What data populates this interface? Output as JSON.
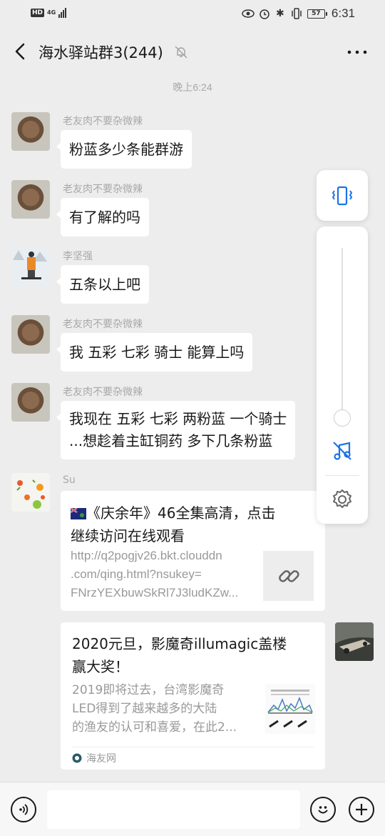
{
  "status_bar": {
    "hd": "HD",
    "network": "4G",
    "battery": "57",
    "time": "6:31"
  },
  "header": {
    "title": "海水驿站群3(244)"
  },
  "timestamp": "晚上6:24",
  "messages": [
    {
      "sender": "老友肉不要杂微辣",
      "text": "粉蓝多少条能群游"
    },
    {
      "sender": "老友肉不要杂微辣",
      "text": "有了解的吗"
    },
    {
      "sender": "李坚强",
      "text": "五条以上吧"
    },
    {
      "sender": "老友肉不要杂微辣",
      "text": "我 五彩 七彩 骑士 能算上吗"
    },
    {
      "sender": "老友肉不要杂微辣",
      "line1": "我现在 五彩 七彩 两粉蓝  一个骑士",
      "line2": "...想趁着主缸铜药  多下几条粉蓝"
    }
  ],
  "link_message": {
    "sender": "Su",
    "title_line1": "《庆余年》46全集高清，点击",
    "title_line2": "继续访问在线观看",
    "url_line1": "http://q2pogjv26.bkt.clouddn",
    "url_line2": ".com/qing.html?nsukey=",
    "url_line3": "FNrzYEXbuwSkRl7J3ludKZw..."
  },
  "article_message": {
    "title_line1": "2020元旦，影魔奇illumagic盖楼",
    "title_line2": "赢大奖！",
    "desc_line1": "2019即将过去，台湾影魔奇",
    "desc_line2": "LED得到了越来越多的大陆",
    "desc_line3": "的渔友的认可和喜爱，在此2...",
    "source": "海友网"
  },
  "colors": {
    "background": "#ededed",
    "bubble": "#ffffff",
    "accent_blue": "#1a73e8"
  }
}
